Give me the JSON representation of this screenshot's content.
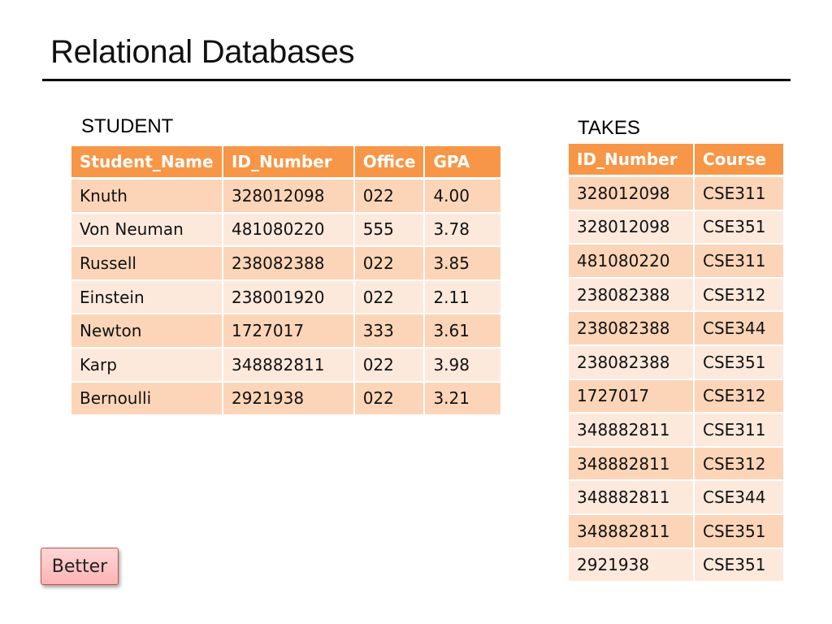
{
  "title": "Relational Databases",
  "student": {
    "caption": "STUDENT",
    "headers": [
      "Student_Name",
      "ID_Number",
      "Office",
      "GPA"
    ],
    "rows": [
      [
        "Knuth",
        "328012098",
        "022",
        "4.00"
      ],
      [
        "Von Neuman",
        "481080220",
        "555",
        "3.78"
      ],
      [
        "Russell",
        "238082388",
        "022",
        "3.85"
      ],
      [
        "Einstein",
        "238001920",
        "022",
        "2.11"
      ],
      [
        "Newton",
        "1727017",
        "333",
        "3.61"
      ],
      [
        "Karp",
        "348882811",
        "022",
        "3.98"
      ],
      [
        "Bernoulli",
        "2921938",
        "022",
        "3.21"
      ]
    ]
  },
  "takes": {
    "caption": "TAKES",
    "headers": [
      "ID_Number",
      "Course"
    ],
    "rows": [
      [
        "328012098",
        "CSE311"
      ],
      [
        "328012098",
        "CSE351"
      ],
      [
        "481080220",
        "CSE311"
      ],
      [
        "238082388",
        "CSE312"
      ],
      [
        "238082388",
        "CSE344"
      ],
      [
        "238082388",
        "CSE351"
      ],
      [
        "1727017",
        "CSE312"
      ],
      [
        "348882811",
        "CSE311"
      ],
      [
        "348882811",
        "CSE312"
      ],
      [
        "348882811",
        "CSE344"
      ],
      [
        "348882811",
        "CSE351"
      ],
      [
        "2921938",
        "CSE351"
      ]
    ]
  },
  "better_button": {
    "label": "Better"
  },
  "colors": {
    "header": "#f79646",
    "row_odd": "#fcd5b8",
    "row_even": "#fde9db",
    "button_border": "#c0504d"
  }
}
